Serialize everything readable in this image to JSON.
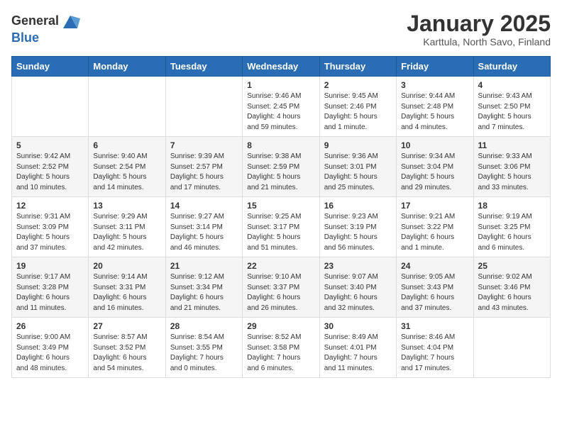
{
  "logo": {
    "general": "General",
    "blue": "Blue"
  },
  "title": "January 2025",
  "subtitle": "Karttula, North Savo, Finland",
  "header_days": [
    "Sunday",
    "Monday",
    "Tuesday",
    "Wednesday",
    "Thursday",
    "Friday",
    "Saturday"
  ],
  "weeks": [
    [
      {
        "day": "",
        "info": ""
      },
      {
        "day": "",
        "info": ""
      },
      {
        "day": "",
        "info": ""
      },
      {
        "day": "1",
        "info": "Sunrise: 9:46 AM\nSunset: 2:45 PM\nDaylight: 4 hours\nand 59 minutes."
      },
      {
        "day": "2",
        "info": "Sunrise: 9:45 AM\nSunset: 2:46 PM\nDaylight: 5 hours\nand 1 minute."
      },
      {
        "day": "3",
        "info": "Sunrise: 9:44 AM\nSunset: 2:48 PM\nDaylight: 5 hours\nand 4 minutes."
      },
      {
        "day": "4",
        "info": "Sunrise: 9:43 AM\nSunset: 2:50 PM\nDaylight: 5 hours\nand 7 minutes."
      }
    ],
    [
      {
        "day": "5",
        "info": "Sunrise: 9:42 AM\nSunset: 2:52 PM\nDaylight: 5 hours\nand 10 minutes."
      },
      {
        "day": "6",
        "info": "Sunrise: 9:40 AM\nSunset: 2:54 PM\nDaylight: 5 hours\nand 14 minutes."
      },
      {
        "day": "7",
        "info": "Sunrise: 9:39 AM\nSunset: 2:57 PM\nDaylight: 5 hours\nand 17 minutes."
      },
      {
        "day": "8",
        "info": "Sunrise: 9:38 AM\nSunset: 2:59 PM\nDaylight: 5 hours\nand 21 minutes."
      },
      {
        "day": "9",
        "info": "Sunrise: 9:36 AM\nSunset: 3:01 PM\nDaylight: 5 hours\nand 25 minutes."
      },
      {
        "day": "10",
        "info": "Sunrise: 9:34 AM\nSunset: 3:04 PM\nDaylight: 5 hours\nand 29 minutes."
      },
      {
        "day": "11",
        "info": "Sunrise: 9:33 AM\nSunset: 3:06 PM\nDaylight: 5 hours\nand 33 minutes."
      }
    ],
    [
      {
        "day": "12",
        "info": "Sunrise: 9:31 AM\nSunset: 3:09 PM\nDaylight: 5 hours\nand 37 minutes."
      },
      {
        "day": "13",
        "info": "Sunrise: 9:29 AM\nSunset: 3:11 PM\nDaylight: 5 hours\nand 42 minutes."
      },
      {
        "day": "14",
        "info": "Sunrise: 9:27 AM\nSunset: 3:14 PM\nDaylight: 5 hours\nand 46 minutes."
      },
      {
        "day": "15",
        "info": "Sunrise: 9:25 AM\nSunset: 3:17 PM\nDaylight: 5 hours\nand 51 minutes."
      },
      {
        "day": "16",
        "info": "Sunrise: 9:23 AM\nSunset: 3:19 PM\nDaylight: 5 hours\nand 56 minutes."
      },
      {
        "day": "17",
        "info": "Sunrise: 9:21 AM\nSunset: 3:22 PM\nDaylight: 6 hours\nand 1 minute."
      },
      {
        "day": "18",
        "info": "Sunrise: 9:19 AM\nSunset: 3:25 PM\nDaylight: 6 hours\nand 6 minutes."
      }
    ],
    [
      {
        "day": "19",
        "info": "Sunrise: 9:17 AM\nSunset: 3:28 PM\nDaylight: 6 hours\nand 11 minutes."
      },
      {
        "day": "20",
        "info": "Sunrise: 9:14 AM\nSunset: 3:31 PM\nDaylight: 6 hours\nand 16 minutes."
      },
      {
        "day": "21",
        "info": "Sunrise: 9:12 AM\nSunset: 3:34 PM\nDaylight: 6 hours\nand 21 minutes."
      },
      {
        "day": "22",
        "info": "Sunrise: 9:10 AM\nSunset: 3:37 PM\nDaylight: 6 hours\nand 26 minutes."
      },
      {
        "day": "23",
        "info": "Sunrise: 9:07 AM\nSunset: 3:40 PM\nDaylight: 6 hours\nand 32 minutes."
      },
      {
        "day": "24",
        "info": "Sunrise: 9:05 AM\nSunset: 3:43 PM\nDaylight: 6 hours\nand 37 minutes."
      },
      {
        "day": "25",
        "info": "Sunrise: 9:02 AM\nSunset: 3:46 PM\nDaylight: 6 hours\nand 43 minutes."
      }
    ],
    [
      {
        "day": "26",
        "info": "Sunrise: 9:00 AM\nSunset: 3:49 PM\nDaylight: 6 hours\nand 48 minutes."
      },
      {
        "day": "27",
        "info": "Sunrise: 8:57 AM\nSunset: 3:52 PM\nDaylight: 6 hours\nand 54 minutes."
      },
      {
        "day": "28",
        "info": "Sunrise: 8:54 AM\nSunset: 3:55 PM\nDaylight: 7 hours\nand 0 minutes."
      },
      {
        "day": "29",
        "info": "Sunrise: 8:52 AM\nSunset: 3:58 PM\nDaylight: 7 hours\nand 6 minutes."
      },
      {
        "day": "30",
        "info": "Sunrise: 8:49 AM\nSunset: 4:01 PM\nDaylight: 7 hours\nand 11 minutes."
      },
      {
        "day": "31",
        "info": "Sunrise: 8:46 AM\nSunset: 4:04 PM\nDaylight: 7 hours\nand 17 minutes."
      },
      {
        "day": "",
        "info": ""
      }
    ]
  ]
}
